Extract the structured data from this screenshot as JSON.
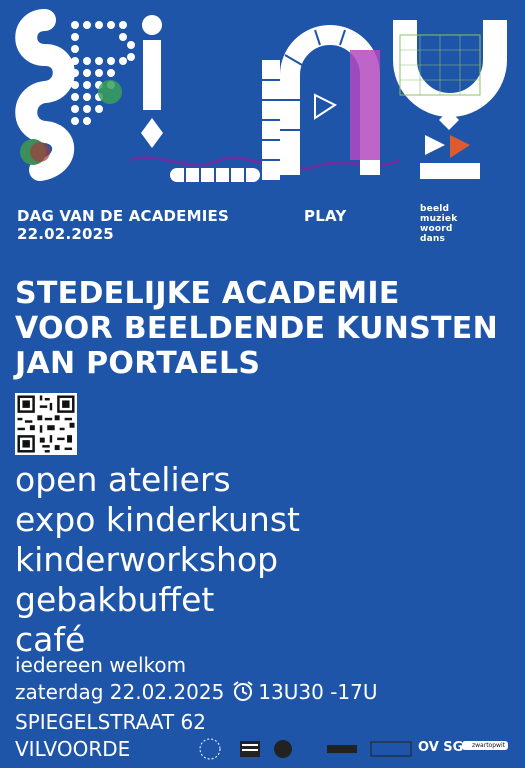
{
  "poster": {
    "event_line1": "DAG VAN DE ACADEMIES",
    "event_date": "22.02.2025",
    "theme": "PLAY",
    "disciplines": [
      "beeld",
      "muziek",
      "woord",
      "dans"
    ],
    "title_lines": [
      "STEDELIJKE ACADEMIE",
      "VOOR BEELDENDE KUNSTEN",
      "JAN PORTAELS"
    ],
    "activities": [
      "open ateliers",
      "expo kinderkunst",
      "kinderworkshop",
      "gebakbuffet",
      "café"
    ],
    "welcome": "iedereen welkom",
    "date_line": "zaterdag 22.02.2025",
    "time": "13U30 -17U",
    "street": "SPIEGELSTRAAT 62",
    "city": "VILVOORDE",
    "sponsor_ovsg": "OV SG",
    "sponsor_zwartopwit": "zwartopwit"
  },
  "icons": [
    "alarm-clock-icon",
    "qr-code"
  ],
  "colors": {
    "background": "#1f55a8",
    "text": "#ffffff"
  }
}
